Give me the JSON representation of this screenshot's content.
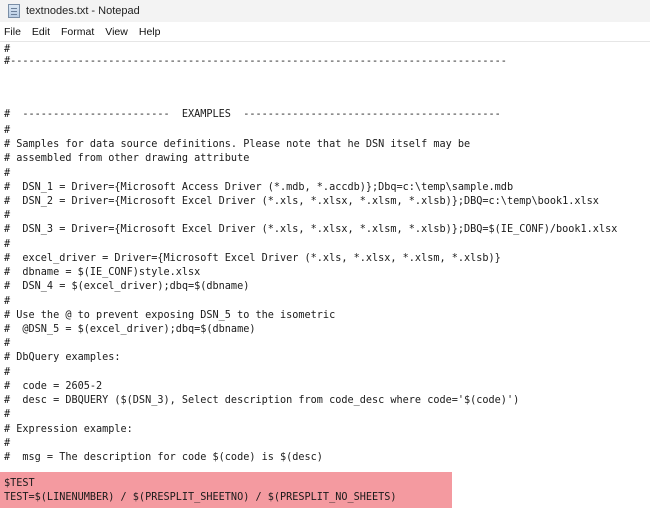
{
  "window": {
    "title": "textnodes.txt - Notepad",
    "icon": "notepad-icon"
  },
  "menu": [
    "File",
    "Edit",
    "Format",
    "View",
    "Help"
  ],
  "colors": {
    "highlight": "#f49aa0",
    "background": "#ffffff",
    "titlebar": "#f3f3f3"
  },
  "editor": {
    "lines": [
      "#",
      "#---------------------------------------------------------------------------------",
      "#  ------------------------  EXAMPLES  ------------------------------------------",
      "#",
      "# Samples for data source definitions. Please note that he DSN itself may be",
      "# assembled from other drawing attribute",
      "#",
      "#  DSN_1 = Driver={Microsoft Access Driver (*.mdb, *.accdb)};Dbq=c:\\temp\\sample.mdb",
      "#  DSN_2 = Driver={Microsoft Excel Driver (*.xls, *.xlsx, *.xlsm, *.xlsb)};DBQ=c:\\temp\\book1.xlsx",
      "#",
      "#  DSN_3 = Driver={Microsoft Excel Driver (*.xls, *.xlsx, *.xlsm, *.xlsb)};DBQ=$(IE_CONF)/book1.xlsx",
      "#",
      "#  excel_driver = Driver={Microsoft Excel Driver (*.xls, *.xlsx, *.xlsm, *.xlsb)}",
      "#  dbname = $(IE_CONF)style.xlsx",
      "#  DSN_4 = $(excel_driver);dbq=$(dbname)",
      "#",
      "# Use the @ to prevent exposing DSN_5 to the isometric",
      "#  @DSN_5 = $(excel_driver);dbq=$(dbname)",
      "#",
      "# DbQuery examples:",
      "#",
      "#  code = 2605-2",
      "#  desc = DBQUERY ($(DSN_3), Select description from code_desc where code='$(code)')",
      "#",
      "# Expression example:",
      "#",
      "#  msg = The description for code $(code) is $(desc)",
      "$TEST",
      "TEST=$(LINENUMBER) / $(PRESPLIT_SHEETNO) / $(PRESPLIT_NO_SHEETS)"
    ]
  }
}
